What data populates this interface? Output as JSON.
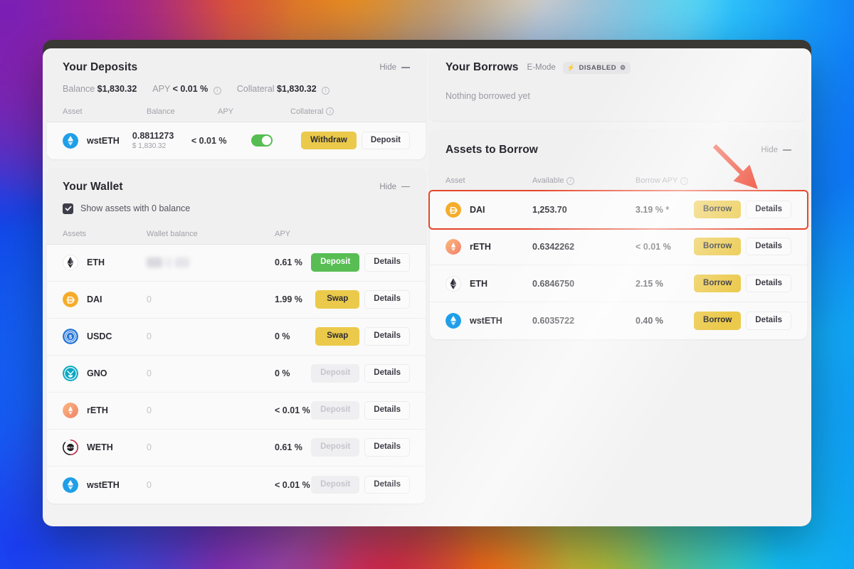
{
  "deposits": {
    "title": "Your Deposits",
    "hide_label": "Hide",
    "summary": [
      {
        "key": "Balance",
        "value": "$1,830.32",
        "info": false
      },
      {
        "key": "APY",
        "value": "< 0.01 %",
        "info": true
      },
      {
        "key": "Collateral",
        "value": "$1,830.32",
        "info": true
      }
    ],
    "columns": [
      "Asset",
      "Balance",
      "APY",
      "Collateral"
    ],
    "rows": [
      {
        "icon": "wsteth-icon",
        "symbol": "wstETH",
        "balance": "0.8811273",
        "balance_usd": "$ 1,830.32",
        "apy": "< 0.01 %",
        "collateral_on": true,
        "primary_action": "Withdraw",
        "secondary_action": "Deposit"
      }
    ]
  },
  "wallet": {
    "title": "Your Wallet",
    "hide_label": "Hide",
    "checkbox_label": "Show assets with 0 balance",
    "checkbox_checked": true,
    "columns": [
      "Assets",
      "Wallet balance",
      "APY"
    ],
    "rows": [
      {
        "icon": "eth-icon",
        "symbol": "ETH",
        "balance": "",
        "balance_hidden": true,
        "apy": "0.61 %",
        "primary_action": "Deposit",
        "primary_style": "green",
        "secondary_action": "Details"
      },
      {
        "icon": "dai-icon",
        "symbol": "DAI",
        "balance": "0",
        "balance_hidden": false,
        "apy": "1.99 %",
        "primary_action": "Swap",
        "primary_style": "yellow",
        "secondary_action": "Details"
      },
      {
        "icon": "usdc-icon",
        "symbol": "USDC",
        "balance": "0",
        "balance_hidden": false,
        "apy": "0 %",
        "primary_action": "Swap",
        "primary_style": "yellow",
        "secondary_action": "Details"
      },
      {
        "icon": "gno-icon",
        "symbol": "GNO",
        "balance": "0",
        "balance_hidden": false,
        "apy": "0 %",
        "primary_action": "Deposit",
        "primary_style": "muted",
        "secondary_action": "Details"
      },
      {
        "icon": "reth-icon",
        "symbol": "rETH",
        "balance": "0",
        "balance_hidden": false,
        "apy": "< 0.01 %",
        "primary_action": "Deposit",
        "primary_style": "muted",
        "secondary_action": "Details"
      },
      {
        "icon": "weth-icon",
        "symbol": "WETH",
        "balance": "0",
        "balance_hidden": false,
        "apy": "0.61 %",
        "primary_action": "Deposit",
        "primary_style": "muted",
        "secondary_action": "Details"
      },
      {
        "icon": "wsteth-icon",
        "symbol": "wstETH",
        "balance": "0",
        "balance_hidden": false,
        "apy": "< 0.01 %",
        "primary_action": "Deposit",
        "primary_style": "muted",
        "secondary_action": "Details"
      }
    ]
  },
  "borrows": {
    "title": "Your Borrows",
    "emode_label": "E-Mode",
    "emode_status": "DISABLED",
    "empty_text": "Nothing borrowed yet"
  },
  "assets_to_borrow": {
    "title": "Assets to Borrow",
    "hide_label": "Hide",
    "columns": [
      "Asset",
      "Available",
      "Borrow APY"
    ],
    "rows": [
      {
        "icon": "dai-icon",
        "symbol": "DAI",
        "available": "1,253.70",
        "apy": "3.19 % *",
        "primary_action": "Borrow",
        "secondary_action": "Details",
        "highlighted": true
      },
      {
        "icon": "reth-icon",
        "symbol": "rETH",
        "available": "0.6342262",
        "apy": "< 0.01 %",
        "primary_action": "Borrow",
        "secondary_action": "Details",
        "highlighted": false
      },
      {
        "icon": "eth-icon",
        "symbol": "ETH",
        "available": "0.6846750",
        "apy": "2.15 %",
        "primary_action": "Borrow",
        "secondary_action": "Details",
        "highlighted": false
      },
      {
        "icon": "wsteth-icon",
        "symbol": "wstETH",
        "available": "0.6035722",
        "apy": "0.40 %",
        "primary_action": "Borrow",
        "secondary_action": "Details",
        "highlighted": false
      }
    ]
  },
  "annotations": {
    "arrow_color": "#ec3b24",
    "highlight_color": "#e8462b"
  },
  "colors": {
    "yellow_button": "#ebc94a",
    "green_button": "#58bd53",
    "toggle_on": "#56bd53",
    "card_bg": "#f0f0f0",
    "row_bg": "#fafafa"
  }
}
